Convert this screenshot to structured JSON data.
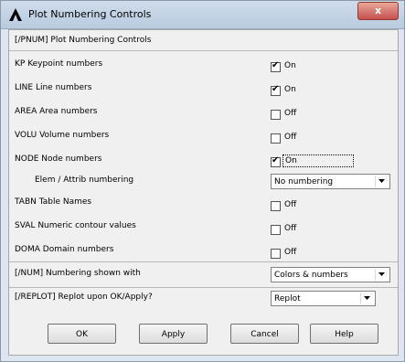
{
  "window": {
    "title": "Plot Numbering Controls",
    "close_label": "x"
  },
  "header": {
    "label": "[/PNUM]  Plot Numbering Controls"
  },
  "rows": [
    {
      "label": "KP   Keypoint numbers",
      "checked": true,
      "state": "On"
    },
    {
      "label": "LINE  Line numbers",
      "checked": true,
      "state": "On"
    },
    {
      "label": "AREA  Area numbers",
      "checked": false,
      "state": "Off"
    },
    {
      "label": "VOLU  Volume numbers",
      "checked": false,
      "state": "Off"
    },
    {
      "label": "NODE  Node numbers",
      "checked": true,
      "state": "On"
    }
  ],
  "elem_attrib": {
    "label": "Elem / Attrib numbering",
    "selected": "No numbering"
  },
  "rows2": [
    {
      "label": "TABN  Table Names",
      "checked": false,
      "state": "Off"
    },
    {
      "label": "SVAL  Numeric contour values",
      "checked": false,
      "state": "Off"
    },
    {
      "label": "DOMA  Domain numbers",
      "checked": false,
      "state": "Off"
    }
  ],
  "num": {
    "label": "[/NUM]  Numbering shown with",
    "selected": "Colors & numbers"
  },
  "replot": {
    "label": "[/REPLOT]  Replot upon OK/Apply?",
    "selected": "Replot"
  },
  "buttons": {
    "ok": "OK",
    "apply": "Apply",
    "cancel": "Cancel",
    "help": "Help"
  }
}
